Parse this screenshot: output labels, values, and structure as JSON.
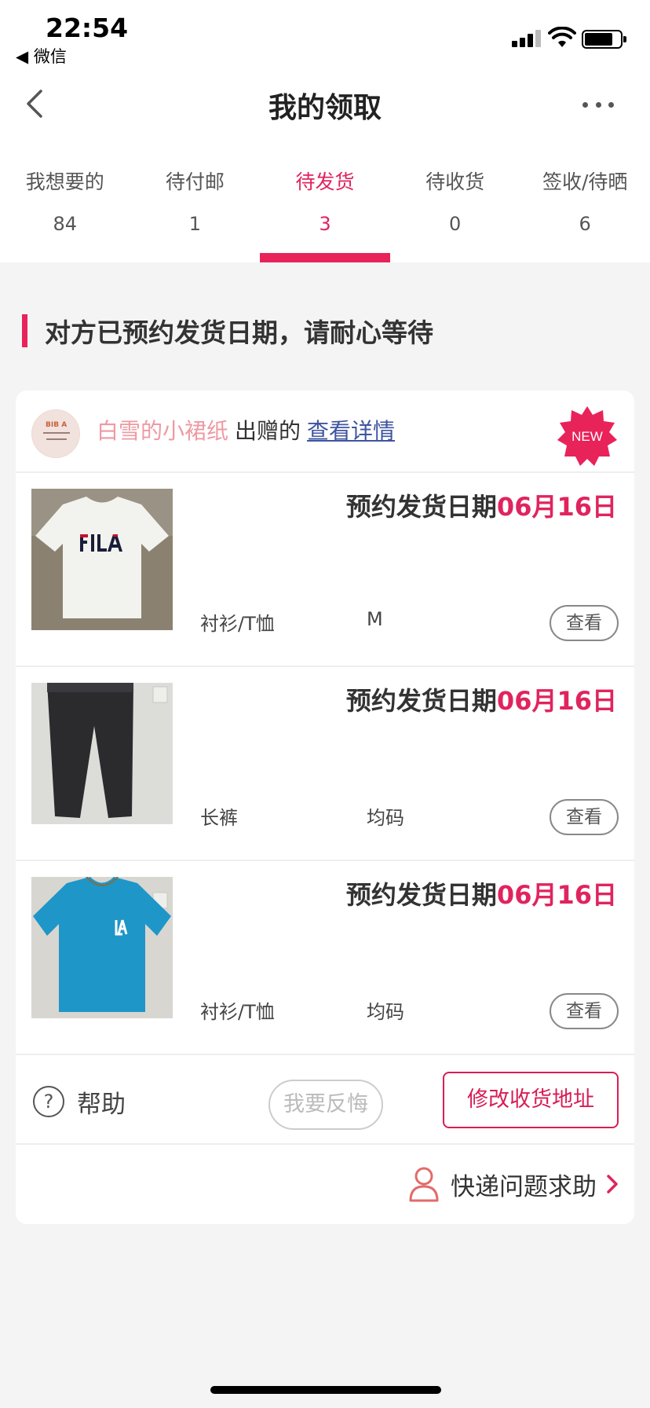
{
  "status_bar": {
    "time": "22:54",
    "back_app": "◀ 微信"
  },
  "nav": {
    "title": "我的领取"
  },
  "tabs": [
    {
      "label": "我想要的",
      "count": "84"
    },
    {
      "label": "待付邮",
      "count": "1"
    },
    {
      "label": "待发货",
      "count": "3"
    },
    {
      "label": "待收货",
      "count": "0"
    },
    {
      "label": "签收/待晒",
      "count": "6"
    }
  ],
  "active_tab": "待发货",
  "notice": {
    "text": "对方已预约发货日期，请耐心等待"
  },
  "giver": {
    "name": "白雪的小裙纸",
    "verb": "出赠的",
    "details_link": "查看详情",
    "badge": "NEW"
  },
  "items": [
    {
      "date_label": "预约发货日期",
      "date_value": "06月16日",
      "category": "衬衫/T恤",
      "size": "M",
      "view_label": "查看",
      "photo": "fila-tshirt-photo"
    },
    {
      "date_label": "预约发货日期",
      "date_value": "06月16日",
      "category": "长裤",
      "size": "均码",
      "view_label": "查看",
      "photo": "black-pants-photo"
    },
    {
      "date_label": "预约发货日期",
      "date_value": "06月16日",
      "category": "衬衫/T恤",
      "size": "均码",
      "view_label": "查看",
      "photo": "blue-la-tshirt-photo"
    }
  ],
  "actions": {
    "help": "帮助",
    "regret": "我要反悔",
    "change_address": "修改收货地址"
  },
  "express_help": {
    "label": "快递问题求助"
  },
  "colors": {
    "accent": "#e8235a",
    "giver_name": "#ee9aa3",
    "link": "#3f55a0",
    "background": "#f4f4f4"
  }
}
